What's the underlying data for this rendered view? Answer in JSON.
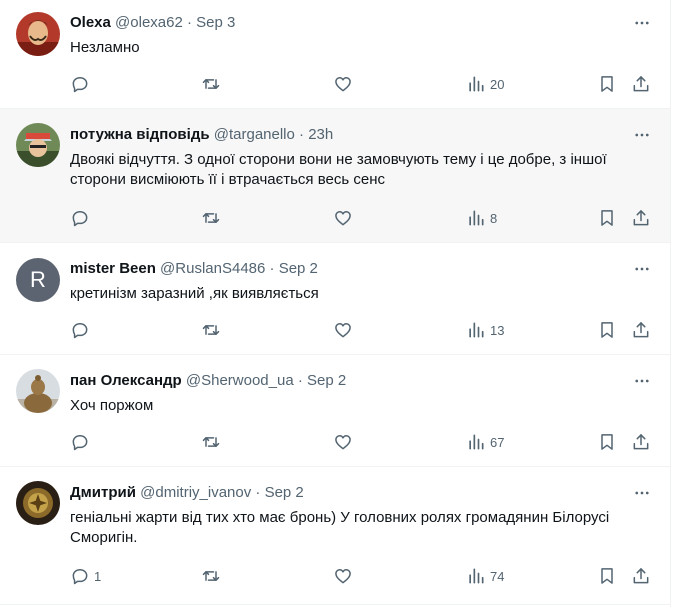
{
  "colors": {
    "text": "#0f1419",
    "muted": "#536471",
    "divider": "#eff3f4",
    "highlight": "#f7f7f7",
    "avatar_gray": "#5b6470"
  },
  "icons": {
    "reply": "reply-icon",
    "retweet": "retweet-icon",
    "like": "heart-icon",
    "views": "views-icon",
    "bookmark": "bookmark-icon",
    "share": "share-icon",
    "more": "more-dots-icon"
  },
  "tweets": [
    {
      "name": "Olexa",
      "handle": "@olexa62",
      "sep": "·",
      "time": "Sep 3",
      "text": "Незламно",
      "replies": "",
      "views": "20"
    },
    {
      "name": "потужна відповідь",
      "handle": "@targanello",
      "sep": "·",
      "time": "23h",
      "text": "Двоякі відчуття. З одної сторони вони не замовчують тему і це добре, з іншої сторони висміюють її і втрачається весь сенс",
      "replies": "",
      "views": "8"
    },
    {
      "name": "mister Been",
      "handle": "@RuslanS4486",
      "sep": "·",
      "time": "Sep 2",
      "text": "кретинізм заразний ,як виявляється",
      "replies": "",
      "views": "13",
      "avatar_letter": "R"
    },
    {
      "name": "пан Олександр",
      "handle": "@Sherwood_ua",
      "sep": "·",
      "time": "Sep 2",
      "text": "Хоч поржом",
      "replies": "",
      "views": "67"
    },
    {
      "name": "Дмитрий",
      "handle": "@dmitriy_ivanov",
      "sep": "·",
      "time": "Sep 2",
      "text": "геніальні жарти від тих хто має бронь) У головних ролях громадянин Білорусі Сморигін.",
      "replies": "1",
      "views": "74"
    }
  ]
}
